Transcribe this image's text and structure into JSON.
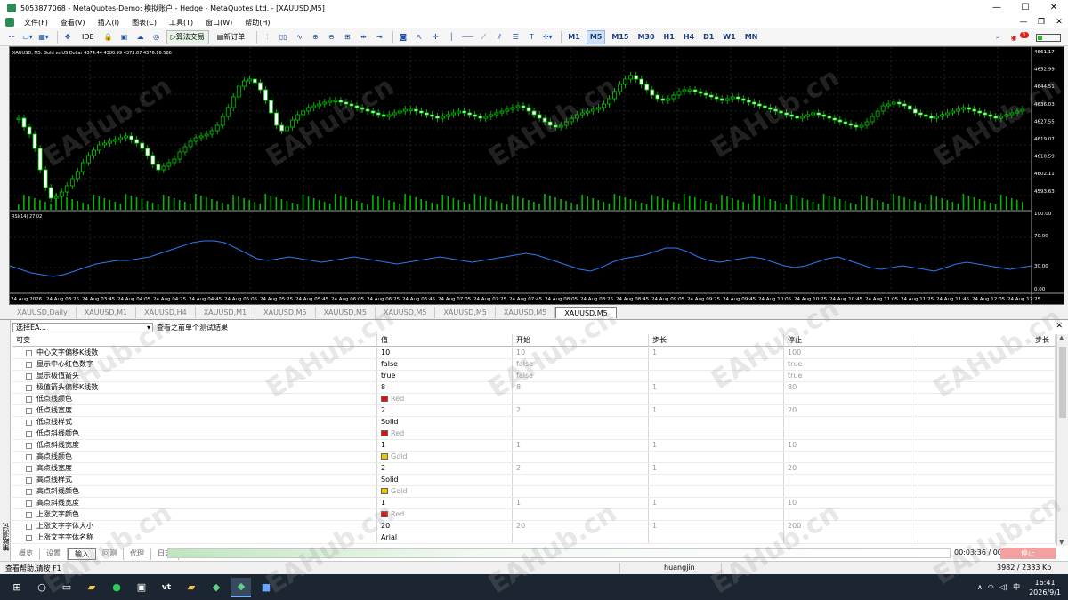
{
  "window": {
    "title": "5053877068 - MetaQuotes-Demo: 模拟账户 - Hedge - MetaQuotes Ltd. - [XAUUSD,M5]",
    "controls": [
      "—",
      "☐",
      "✕"
    ]
  },
  "menu": {
    "items": [
      "文件(F)",
      "查看(V)",
      "插入(I)",
      "图表(C)",
      "工具(T)",
      "窗口(W)",
      "帮助(H)"
    ],
    "mdi": [
      "—",
      "❐",
      "✕"
    ]
  },
  "toolbar": {
    "ide_label": "IDE",
    "algo_label": "算法交易",
    "new_order_label": "新订单",
    "timeframes": [
      "M1",
      "M5",
      "M15",
      "M30",
      "H1",
      "H4",
      "D1",
      "W1",
      "MN"
    ],
    "active_timeframe": "M5",
    "notification_count": "1",
    "battery_level": 0.2
  },
  "chart": {
    "symbol_info": "XAUUSD, M5:  Gold vs US Dollar  4374.44 4380.99 4373.87 4376.16  586",
    "price_labels": [
      "4661.17",
      "4652.99",
      "4644.51",
      "4636.03",
      "4627.55",
      "4619.07",
      "4610.59",
      "4602.11",
      "4593.63"
    ],
    "indicator_label": "RSI(14) 27.02",
    "rsi_labels": [
      "100.00",
      "70.00",
      "30.00",
      "0.00"
    ],
    "time_labels": [
      "24 Aug 2026",
      "24 Aug 03:25",
      "24 Aug 03:45",
      "24 Aug 04:05",
      "24 Aug 04:25",
      "24 Aug 04:45",
      "24 Aug 05:05",
      "24 Aug 05:25",
      "24 Aug 05:45",
      "24 Aug 06:05",
      "24 Aug 06:25",
      "24 Aug 06:45",
      "24 Aug 07:05",
      "24 Aug 07:25",
      "24 Aug 07:45",
      "24 Aug 08:05",
      "24 Aug 08:25",
      "24 Aug 08:45",
      "24 Aug 09:05",
      "24 Aug 09:25",
      "24 Aug 09:45",
      "24 Aug 10:05",
      "24 Aug 10:25",
      "24 Aug 10:45",
      "24 Aug 11:05",
      "24 Aug 11:25",
      "24 Aug 11:45",
      "24 Aug 12:05",
      "24 Aug 12:25"
    ]
  },
  "chart_tabs": [
    "XAUUSD,Daily",
    "XAUUSD,M1",
    "XAUUSD,H4",
    "XAUUSD,M1",
    "XAUUSD,M5",
    "XAUUSD,M5",
    "XAUUSD,M5",
    "XAUUSD,M5",
    "XAUUSD,M5",
    "XAUUSD,M5"
  ],
  "chart_tabs_active": 9,
  "tester": {
    "side_label": "策略测试",
    "select_ea": "选择EA...",
    "view_previous": "查看之前单个测试结果",
    "close": "✕",
    "columns": [
      "可变",
      "值",
      "开始",
      "步长",
      "停止",
      "步长"
    ],
    "rows": [
      {
        "name": "中心文字偏移K线数",
        "value": "10",
        "start": "10",
        "step": "1",
        "stop": "100"
      },
      {
        "name": "显示中心红色数字",
        "value": "false",
        "start": "false",
        "step": "",
        "stop": "true"
      },
      {
        "name": "显示极值箭头",
        "value": "true",
        "start": "false",
        "step": "",
        "stop": "true"
      },
      {
        "name": "极值箭头偏移K线数",
        "value": "8",
        "start": "8",
        "step": "1",
        "stop": "80"
      },
      {
        "name": "低点线颜色",
        "value": "Red",
        "color": "#e01010",
        "start": "",
        "step": "",
        "stop": ""
      },
      {
        "name": "低点线宽度",
        "value": "2",
        "start": "2",
        "step": "1",
        "stop": "20"
      },
      {
        "name": "低点线样式",
        "value": "Solid",
        "start": "",
        "step": "",
        "stop": ""
      },
      {
        "name": "低点斜线颜色",
        "value": "Red",
        "color": "#e01010",
        "start": "",
        "step": "",
        "stop": ""
      },
      {
        "name": "低点斜线宽度",
        "value": "1",
        "start": "1",
        "step": "1",
        "stop": "10"
      },
      {
        "name": "高点线颜色",
        "value": "Gold",
        "color": "#f0c800",
        "start": "",
        "step": "",
        "stop": ""
      },
      {
        "name": "高点线宽度",
        "value": "2",
        "start": "2",
        "step": "1",
        "stop": "20"
      },
      {
        "name": "高点线样式",
        "value": "Solid",
        "start": "",
        "step": "",
        "stop": ""
      },
      {
        "name": "高点斜线颜色",
        "value": "Gold",
        "color": "#f0c800",
        "start": "",
        "step": "",
        "stop": ""
      },
      {
        "name": "高点斜线宽度",
        "value": "1",
        "start": "1",
        "step": "1",
        "stop": "10"
      },
      {
        "name": "上涨文字颜色",
        "value": "Red",
        "color": "#e01010",
        "start": "",
        "step": "",
        "stop": ""
      },
      {
        "name": "上涨文字字体大小",
        "value": "20",
        "start": "20",
        "step": "1",
        "stop": "200"
      },
      {
        "name": "上涨文字字体名称",
        "value": "Arial",
        "start": "",
        "step": "",
        "stop": ""
      }
    ],
    "bottom_tabs": [
      "概览",
      "设置",
      "输入",
      "回测",
      "代理",
      "日志"
    ],
    "active_bottom_tab": 2,
    "elapsed": "00:03:36 / 00:20:55",
    "stop_label": "停止"
  },
  "status": {
    "help": "查看帮助,请按 F1",
    "user": "huangjin",
    "connection": "3982 / 2333 Kb"
  },
  "taskbar": {
    "ime": "中",
    "time": "16:41",
    "date": "2026/9/1"
  },
  "watermark": "EAHub.cn"
}
